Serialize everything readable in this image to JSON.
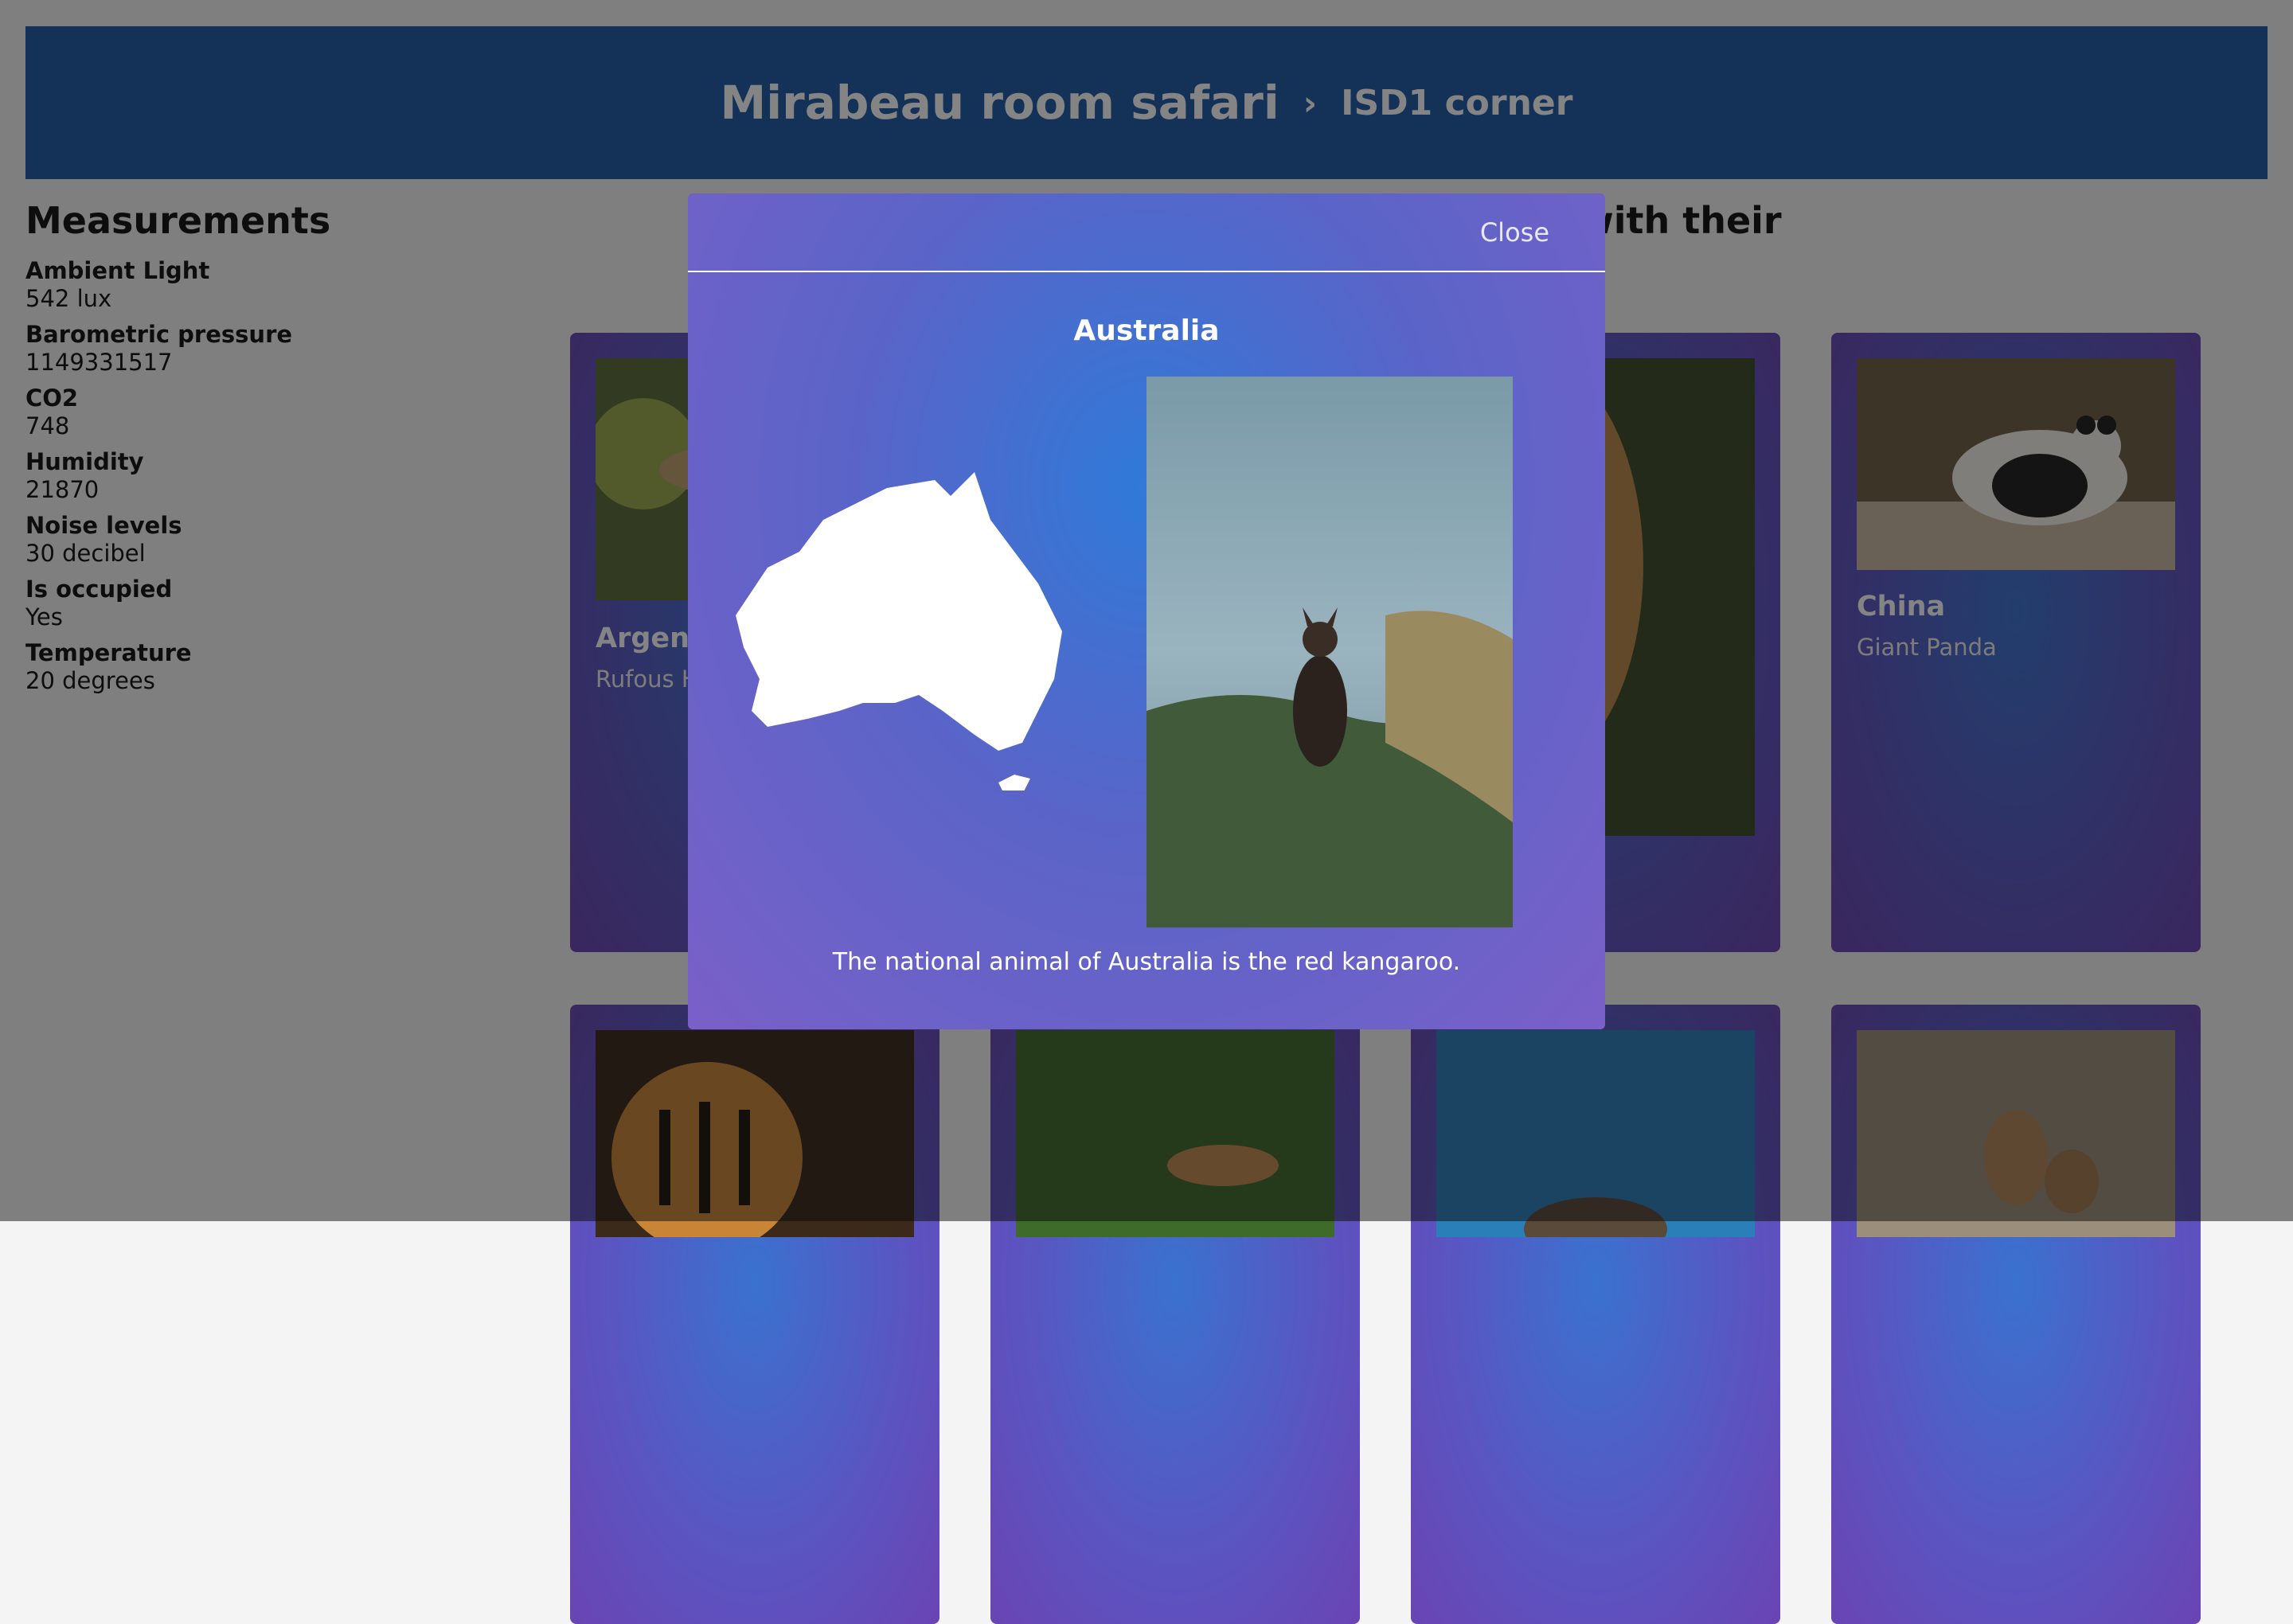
{
  "header": {
    "title": "Mirabeau room safari",
    "separator": "›",
    "subtitle": "ISD1 corner"
  },
  "measurements": {
    "heading": "Measurements",
    "items": [
      {
        "label": "Ambient Light",
        "value": "542 lux"
      },
      {
        "label": "Barometric pressure",
        "value": "1149331517"
      },
      {
        "label": "CO2",
        "value": "748"
      },
      {
        "label": "Humidity",
        "value": "21870"
      },
      {
        "label": "Noise levels",
        "value": "30 decibel"
      },
      {
        "label": "Is occupied",
        "value": "Yes"
      },
      {
        "label": "Temperature",
        "value": "20 degrees"
      }
    ]
  },
  "intro_heading_visible": "ditions with their",
  "cards": [
    {
      "title": "Argenti",
      "subtitle": "Rufous H",
      "icon": "bird-photo"
    },
    {
      "title": "China",
      "subtitle": "Giant Panda",
      "icon": "panda-photo"
    }
  ],
  "modal": {
    "close_label": "Close",
    "country": "Australia",
    "caption": "The national animal of Australia is the red kangaroo.",
    "colors": {
      "accent": "#1f5aa6",
      "modal_center": "#2f7ad8",
      "modal_edge": "#7a60c8"
    }
  }
}
